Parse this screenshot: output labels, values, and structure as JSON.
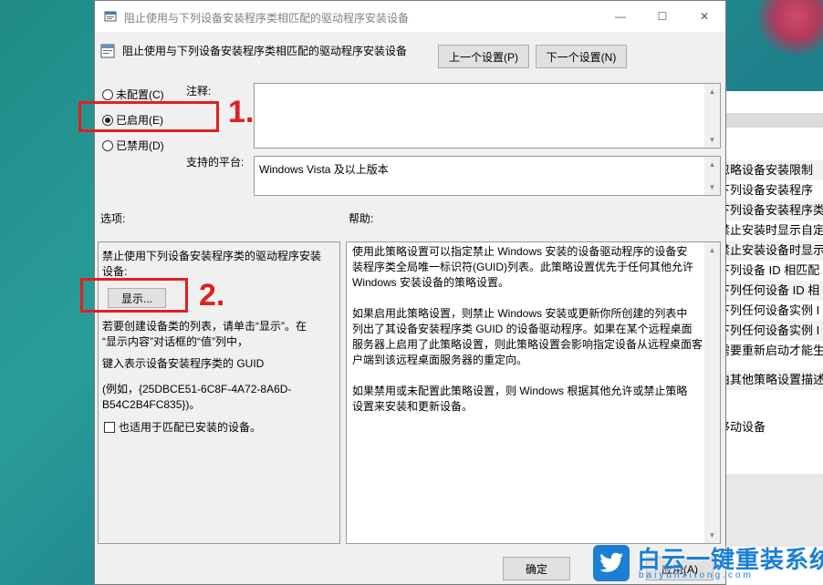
{
  "window": {
    "title": "阻止使用与下列设备安装程序类相匹配的驱动程序安装设备",
    "minimize": "—",
    "maximize": "☐",
    "close": "✕"
  },
  "header": {
    "policy_name": "阻止使用与下列设备安装程序类相匹配的驱动程序安装设备",
    "prev_button": "上一个设置(P)",
    "next_button": "下一个设置(N)"
  },
  "state": {
    "options": [
      {
        "label": "未配置(C)",
        "selected": false
      },
      {
        "label": "已启用(E)",
        "selected": true
      },
      {
        "label": "已禁用(D)",
        "selected": false
      }
    ]
  },
  "comment": {
    "label": "注释:",
    "value": ""
  },
  "platform": {
    "label": "支持的平台:",
    "value": "Windows Vista 及以上版本"
  },
  "sections": {
    "options_label": "选项:",
    "help_label": "帮助:"
  },
  "options_panel": {
    "line1": "禁止使用下列设备安装程序类的驱动程序安装",
    "line2": "设备:",
    "show_button": "显示...",
    "hint1": "若要创建设备类的列表，请单击“显示”。在",
    "hint2": "“显示内容”对话框的“值”列中，",
    "hint3": "键入表示设备安装程序类的 GUID",
    "example1": "(例如，{25DBCE51-6C8F-4A72-8A6D-",
    "example2": "B54C2B4FC835})。",
    "checkbox_label": "也适用于匹配已安装的设备。",
    "checkbox_checked": false
  },
  "help_panel": {
    "p1_l1": "使用此策略设置可以指定禁止 Windows 安装的设备驱动程序的设备安",
    "p1_l2": "装程序类全局唯一标识符(GUID)列表。此策略设置优先于任何其他允许",
    "p1_l3": "Windows 安装设备的策略设置。",
    "p2_l1": "如果启用此策略设置，则禁止 Windows 安装或更新你所创建的列表中",
    "p2_l2": "列出了其设备安装程序类 GUID 的设备驱动程序。如果在某个远程桌面",
    "p2_l3": "服务器上启用了此策略设置，则此策略设置会影响指定设备从远程桌面客",
    "p2_l4": "户端到该远程桌面服务器的重定向。",
    "p3_l1": "如果禁用或未配置此策略设置，则 Windows 根据其他允许或禁止策略",
    "p3_l2": "设置来安装和更新设备。"
  },
  "footer": {
    "ok_button": "确定",
    "apply_button": "应用(A)"
  },
  "annotations": {
    "step1": "1.",
    "step2": "2."
  },
  "background_list": [
    "忽略设备安装限制",
    "下列设备安装程序",
    "下列设备安装程序类",
    "禁止安装时显示自定",
    "禁止安装设备时显示",
    "下列设备 ID 相匹配",
    "下列任何设备 ID 相",
    "下列任何设备实例 I",
    "下列任何设备实例 I",
    "需要重新启动才能生",
    "由其他策略设置描述"
  ],
  "background_extra": "移动设备",
  "watermark": {
    "text": "白云一键重装系统",
    "url": "baiyunxitong.com"
  },
  "colors": {
    "annotation": "#e02020",
    "watermark": "#1c7fd4"
  }
}
